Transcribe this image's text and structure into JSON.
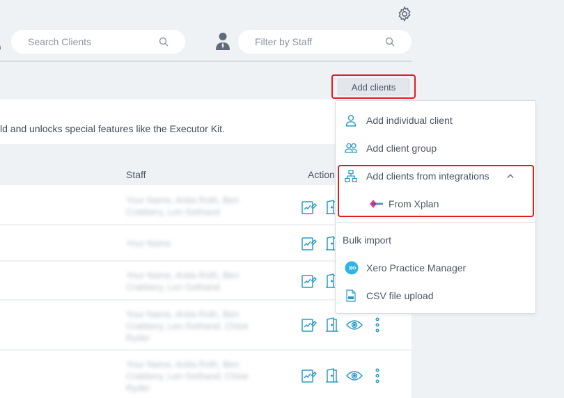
{
  "search": {
    "placeholder": "Search Clients"
  },
  "filter": {
    "placeholder": "Filter by Staff"
  },
  "add_button": {
    "label": "Add clients"
  },
  "banner": {
    "text": "ld and unlocks special features like the Executor Kit."
  },
  "table": {
    "headers": {
      "staff": "Staff",
      "actions": "Action"
    },
    "rows": [
      {
        "staff": "Your Name, Anita Roth, Ben Crabbery, Len Gethand"
      },
      {
        "staff": "Your Name"
      },
      {
        "staff": "Your Name, Anita Roth, Ben Crabbery, Len Gethand"
      },
      {
        "staff": "Your Name, Anita Roth, Ben Crabbery, Len Gethand, Chloe Ryder"
      },
      {
        "staff": "Your Name, Anita Roth, Ben Crabbery, Len Gethand, Chloe Ryder"
      }
    ]
  },
  "menu": {
    "items": [
      {
        "label": "Add individual client",
        "icon": "user-icon"
      },
      {
        "label": "Add client group",
        "icon": "users-icon"
      },
      {
        "label": "Add clients from integrations",
        "icon": "network-icon"
      },
      {
        "label": "From Xplan",
        "icon": "xplan-logo"
      }
    ],
    "bulk_label": "Bulk import",
    "bulk_items": [
      {
        "label": "Xero Practice Manager",
        "icon": "xero-logo"
      },
      {
        "label": "CSV file upload",
        "icon": "csv-file-icon"
      }
    ]
  },
  "colors": {
    "accent": "#2a9bc4",
    "highlight": "#e11d1d",
    "background": "#eff2f5"
  }
}
